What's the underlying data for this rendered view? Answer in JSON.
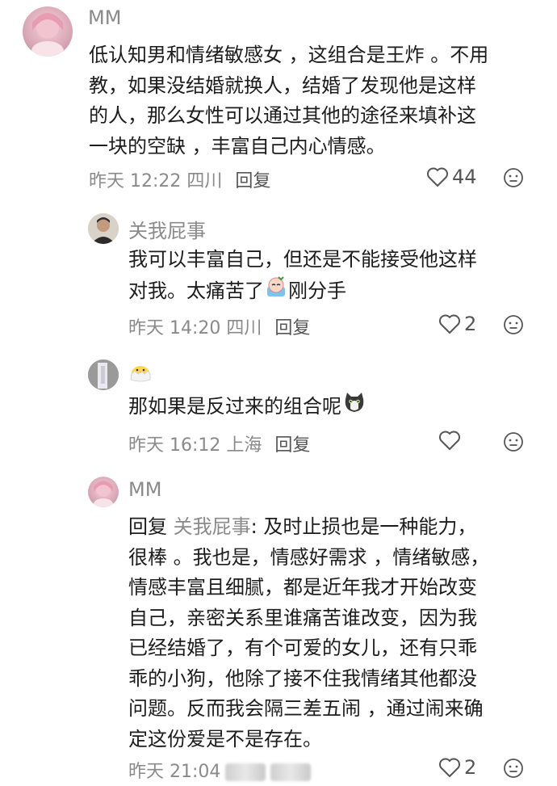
{
  "comments": [
    {
      "username": "MM",
      "lines": [
        "低认知男和情绪敏感女 ，这组合是王炸 。不用",
        "教，如果没结婚就换人，结婚了发现他是这样",
        "的人，那么女性可以通过其他的途径来填补这",
        "一块的空缺 ，丰富自己内心情感。"
      ],
      "time": "昨天 12:22 四川",
      "reply_label": "回复",
      "likes": "44"
    },
    {
      "username": "关我屁事",
      "line1": "我可以丰富自己，但还是不能接受他这样",
      "line2_before": "对我。太痛苦了",
      "line2_after": "刚分手",
      "time": "昨天 14:20 四川",
      "reply_label": "回复",
      "likes": "2"
    },
    {
      "username": "",
      "text_before": "那如果是反过来的组合呢",
      "time": "昨天 16:12 上海",
      "reply_label": "回复",
      "likes": ""
    },
    {
      "username": "MM",
      "reply_prefix": "回复",
      "reply_target": "关我屁事",
      "line1_rest": ": 及时止损也是一种能力，",
      "lines": [
        "很棒 。我也是，情感好需求 ，情绪敏感，",
        "情感丰富且细腻，都是近年我才开始改变",
        "自己，亲密关系里谁痛苦谁改变，因为我",
        "已经结婚了，有个可爱的女儿，还有只乖",
        "乖的小狗，他除了接不住我情绪其他都没",
        "问题。反而我会隔三差五闹 ，通过闹来确",
        "定这份爱是不是存在。"
      ],
      "time": "昨天 21:04",
      "likes": "2"
    }
  ]
}
